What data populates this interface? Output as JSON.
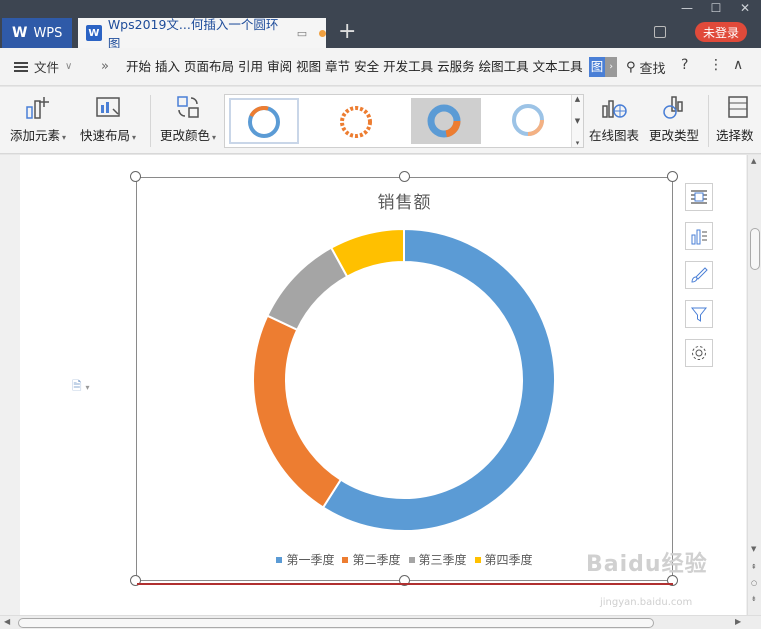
{
  "titlebar": {
    "app_tab": "WPS",
    "doc_tab_title": "Wps2019文...何插入一个圆环图",
    "new_tab": "+",
    "login_button": "未登录"
  },
  "menubar": {
    "file_label": "文件",
    "tabs": [
      "开始",
      "插入",
      "页面布局",
      "引用",
      "审阅",
      "视图",
      "章节",
      "安全",
      "开发工具",
      "云服务",
      "绘图工具",
      "文本工具",
      "图"
    ],
    "active_tab": "图",
    "search_label": "查找"
  },
  "toolbar": {
    "add_element": "添加元素",
    "quick_layout": "快速布局",
    "change_color": "更改颜色",
    "online_chart": "在线图表",
    "change_type": "更改类型",
    "select_data": "选择数"
  },
  "chart_data": {
    "type": "donut",
    "title": "销售额",
    "categories": [
      "第一季度",
      "第二季度",
      "第三季度",
      "第四季度"
    ],
    "values": [
      59,
      23,
      10,
      8
    ],
    "colors": [
      "#5b9bd5",
      "#ed7d31",
      "#a5a5a5",
      "#ffc000"
    ],
    "legend_position": "bottom"
  },
  "watermark": {
    "text": "Baidu经验",
    "subtext": "jingyan.baidu.com"
  }
}
